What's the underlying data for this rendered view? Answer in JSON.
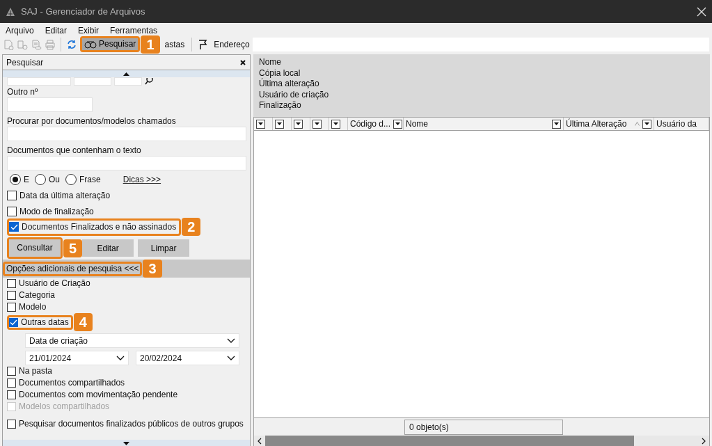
{
  "window": {
    "title": "SAJ - Gerenciador de Arquivos"
  },
  "menu": [
    {
      "label": "Arquivo"
    },
    {
      "label": "Editar"
    },
    {
      "label": "Exibir"
    },
    {
      "label": "Ferramentas"
    }
  ],
  "toolbar": [
    {
      "kind": "new-doc",
      "disabled": true
    },
    {
      "kind": "new-copy",
      "disabled": true
    },
    {
      "kind": "sign-doc",
      "disabled": true
    },
    {
      "kind": "print",
      "disabled": true
    },
    {
      "kind": "separator"
    },
    {
      "kind": "refresh",
      "disabled": false
    },
    {
      "kind": "search-button",
      "label": "Pesquisar",
      "selected": true,
      "callout": "1"
    },
    {
      "kind": "button",
      "label": "astas",
      "selected": false
    },
    {
      "kind": "separator"
    },
    {
      "kind": "pin",
      "disabled": false
    },
    {
      "kind": "label",
      "label": "Endereço"
    },
    {
      "kind": "field"
    }
  ],
  "search_panel": {
    "title": "Pesquisar",
    "fields": [
      {
        "label": "Outro nº",
        "kind": "short"
      },
      {
        "label": "Procurar por documentos/modelos chamados",
        "kind": "wide"
      },
      {
        "label": "Documentos que contenham o texto",
        "kind": "wide"
      }
    ],
    "match_options": [
      {
        "label": "E",
        "selected": true
      },
      {
        "label": "Ou",
        "selected": false
      },
      {
        "label": "Frase",
        "selected": false
      }
    ],
    "tips_link": "Dicas >>>",
    "filters": [
      {
        "label": "Data da última alteração",
        "checked": false
      },
      {
        "label": "Modo de finalização",
        "checked": false
      },
      {
        "label": "Documentos Finalizados e não assinados",
        "checked": true,
        "callout": "2"
      }
    ],
    "buttons": [
      {
        "label": "Consultar",
        "callout": "5"
      },
      {
        "label": "Editar"
      },
      {
        "label": "Limpar"
      }
    ],
    "additional": {
      "title": "Opções adicionais de pesquisa <<<",
      "callout": "3",
      "options": [
        {
          "label": "Usuário de Criação",
          "checked": false,
          "disabled": false
        },
        {
          "label": "Categoria",
          "checked": false,
          "disabled": false
        },
        {
          "label": "Modelo",
          "checked": false,
          "disabled": false
        },
        {
          "label": "Outras datas",
          "checked": true,
          "disabled": false,
          "callout": "4",
          "date_type": "Data de criação",
          "date_from": "21/01/2024",
          "date_to": "20/02/2024"
        },
        {
          "label": "Na pasta",
          "checked": false,
          "disabled": false
        },
        {
          "label": "Documentos compartilhados",
          "checked": false,
          "disabled": false
        },
        {
          "label": "Documentos com movimentação pendente",
          "checked": false,
          "disabled": false
        },
        {
          "label": "Modelos compartilhados",
          "checked": false,
          "disabled": true
        },
        {
          "label": "Pesquisar documentos finalizados públicos de outros grupos",
          "checked": false,
          "disabled": false
        }
      ]
    }
  },
  "details": [
    "Nome",
    "Cópia local",
    "Última alteração",
    "Usuário de criação",
    "Finalização"
  ],
  "grid": {
    "columns": [
      {
        "kind": "icon-only",
        "filter": true
      },
      {
        "kind": "icon-only",
        "filter": true
      },
      {
        "kind": "icon-only",
        "filter": true
      },
      {
        "kind": "icon-only",
        "filter": true
      },
      {
        "kind": "icon-only",
        "filter": true
      },
      {
        "kind": "text",
        "label": "Código d...",
        "filter": true,
        "sorted": false
      },
      {
        "kind": "text",
        "label": "Nome",
        "filter": true,
        "sorted": false
      },
      {
        "kind": "text",
        "label": "Última Alteração",
        "filter": true,
        "sorted": true
      },
      {
        "kind": "text",
        "label": "Usuário da",
        "filter": false,
        "sorted": false
      }
    ]
  },
  "status_bar": "0 objeto(s)"
}
